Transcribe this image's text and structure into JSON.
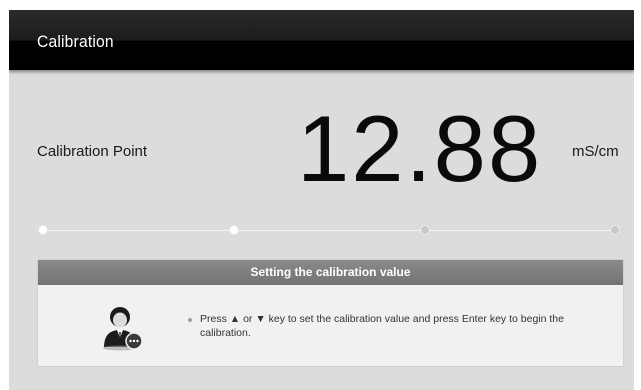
{
  "window": {
    "title": "Calibration"
  },
  "calibration": {
    "label": "Calibration Point",
    "value": "12.88",
    "unit": "mS/cm"
  },
  "progress": {
    "steps_total": 4,
    "steps_completed": 2
  },
  "panel": {
    "header": "Setting the calibration value",
    "instruction": "Press ▲ or ▼ key to set the calibration value and press Enter key to begin the calibration.",
    "icon": "user-support-icon"
  },
  "colors": {
    "title_bar": "#000000",
    "background": "#dcdcdc",
    "panel_header": "#7d7d7d"
  }
}
